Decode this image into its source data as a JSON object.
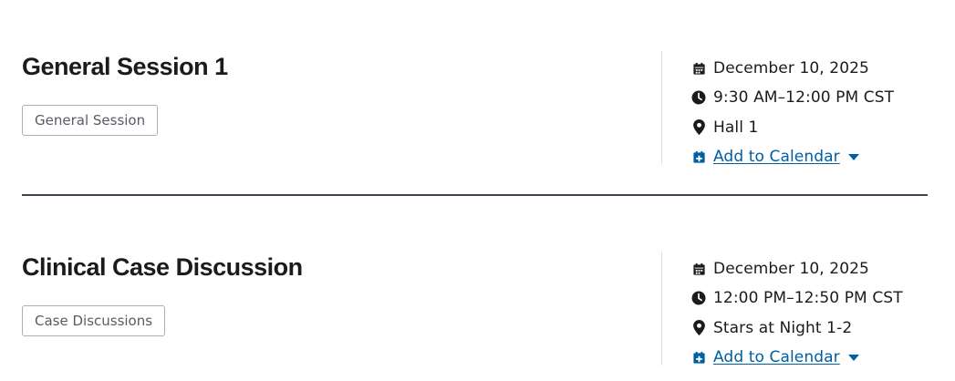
{
  "sessions": [
    {
      "title": "General Session 1",
      "tag": "General Session",
      "date": "December 10, 2025",
      "time": "9:30 AM–12:00 PM CST",
      "location": "Hall 1",
      "calendar_label": "Add to Calendar"
    },
    {
      "title": "Clinical Case Discussion",
      "tag": "Case Discussions",
      "date": "December 10, 2025",
      "time": "12:00 PM–12:50 PM CST",
      "location": "Stars at Night 1-2",
      "calendar_label": "Add to Calendar"
    }
  ],
  "icons": {
    "date": "calendar-icon",
    "time": "clock-icon",
    "location": "map-pin-icon",
    "calendar": "calendar-add-icon",
    "dropdown": "caret-down-icon"
  },
  "colors": {
    "text": "#1b1b1b",
    "link": "#005ea2",
    "tag_border": "#a9aeb1",
    "tag_text": "#565c65",
    "divider": "#3d4551"
  }
}
